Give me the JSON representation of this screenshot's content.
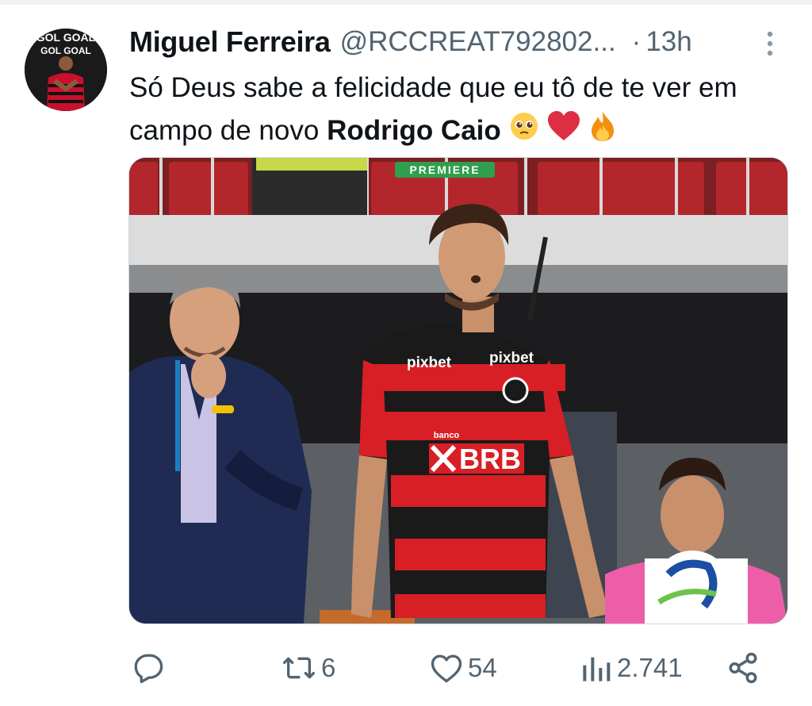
{
  "tweet": {
    "display_name": "Miguel Ferreira",
    "handle": "@RCCREAT792802...",
    "separator": "·",
    "time": "13h",
    "text_part1": "Só Deus sabe a felicidade que eu tô de te ver em campo de novo ",
    "text_bold": "Rodrigo Caio",
    "emojis": [
      "pleading-face",
      "red-heart",
      "fire"
    ]
  },
  "avatar": {
    "text_top": "GOL GOAL",
    "text_bottom": "GOL GOAL"
  },
  "media": {
    "broadcast_badge": "PREMIERE",
    "jersey_sponsor_top": "pixbet",
    "jersey_sponsor_main": "BRB",
    "jersey_sponsor_small": "banco",
    "description_colors": {
      "jersey_red": "#d81f26",
      "jersey_black": "#1a1a1a",
      "seats": "#b3262b"
    }
  },
  "actions": {
    "reply_count": "",
    "retweet_count": "6",
    "like_count": "54",
    "views_count": "2.741"
  },
  "colors": {
    "text": "#0f1419",
    "secondary": "#536471"
  }
}
